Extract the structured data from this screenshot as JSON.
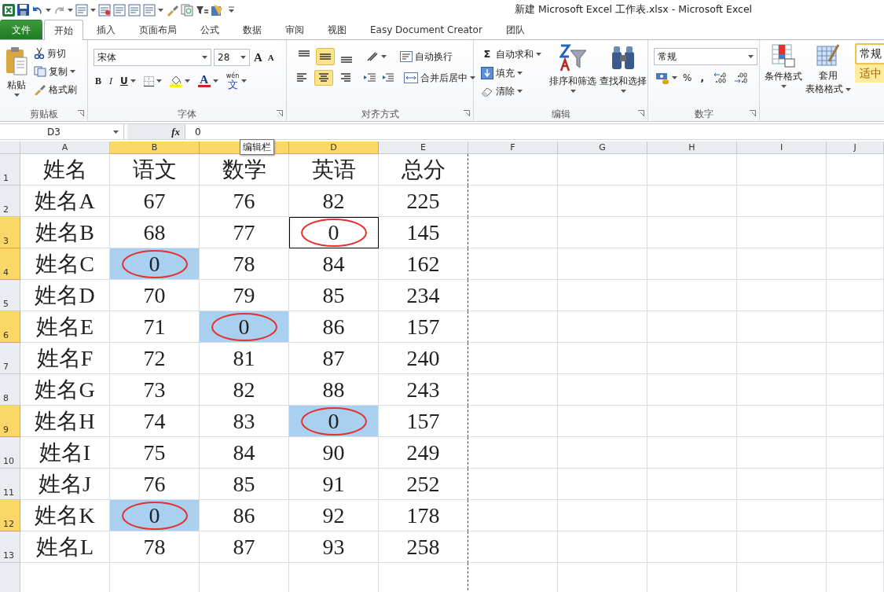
{
  "window": {
    "title": "新建 Microsoft Excel 工作表.xlsx  -  Microsoft Excel"
  },
  "tabs": [
    {
      "label": "文件",
      "kind": "file",
      "selected": false
    },
    {
      "label": "开始",
      "kind": "tab",
      "selected": true
    },
    {
      "label": "插入",
      "kind": "tab",
      "selected": false
    },
    {
      "label": "页面布局",
      "kind": "tab",
      "selected": false
    },
    {
      "label": "公式",
      "kind": "tab",
      "selected": false
    },
    {
      "label": "数据",
      "kind": "tab",
      "selected": false
    },
    {
      "label": "审阅",
      "kind": "tab",
      "selected": false
    },
    {
      "label": "视图",
      "kind": "tab",
      "selected": false
    },
    {
      "label": "Easy Document Creator",
      "kind": "tab",
      "selected": false
    },
    {
      "label": "团队",
      "kind": "tab",
      "selected": false
    }
  ],
  "ribbon": {
    "clipboard": {
      "title": "剪贴板",
      "paste": "粘贴",
      "cut": "剪切",
      "copy": "复制",
      "format_painter": "格式刷"
    },
    "font": {
      "title": "字体",
      "font_name": "宋体",
      "font_size": "28",
      "grow": "A",
      "shrink": "A",
      "bold": "B",
      "italic": "I",
      "underline": "U",
      "font_color": "A",
      "phonetic_top": "wén",
      "phonetic_main": "文"
    },
    "alignment": {
      "title": "对齐方式",
      "vertical": [
        {
          "selected": false
        },
        {
          "selected": true
        },
        {
          "selected": false
        }
      ],
      "horizontal": [
        {
          "selected": false
        },
        {
          "selected": true
        },
        {
          "selected": false
        }
      ],
      "wrap_text": "自动换行",
      "merge_center": "合并后居中"
    },
    "editing": {
      "title": "编辑",
      "autosum": "自动求和",
      "autosum_symbol": "Σ",
      "fill": "填充",
      "clear": "清除",
      "sort_filter": "排序和筛选",
      "find_select": "查找和选择"
    },
    "number": {
      "title": "数字",
      "format": "常规",
      "percent": "%",
      "comma": ","
    },
    "styles": {
      "conditional": "条件格式",
      "table_format_top": "套用",
      "table_format_bottom": "表格格式",
      "style_normal": "常规",
      "style_neutral": "适中"
    }
  },
  "formula_bar": {
    "name_box": "D3",
    "function_label": "fx",
    "formula": "0",
    "tooltip": "编辑栏"
  },
  "sheet": {
    "columns": [
      {
        "letter": "A",
        "selected": false
      },
      {
        "letter": "B",
        "selected": true
      },
      {
        "selected": true
      },
      {
        "letter": "D",
        "selected": true
      },
      {
        "letter": "E",
        "selected": false
      },
      {
        "letter": "F",
        "selected": false
      },
      {
        "letter": "G",
        "selected": false
      },
      {
        "letter": "H",
        "selected": false
      },
      {
        "letter": "I",
        "selected": false
      },
      {
        "letter": "J",
        "selected": false
      }
    ],
    "rows": [
      {
        "number": "1",
        "selected": false,
        "cells": [
          {
            "text": "姓名",
            "selected": false,
            "circled": false,
            "active": false
          },
          {
            "text": "语文",
            "selected": false,
            "circled": false,
            "active": false
          },
          {
            "text": "数学",
            "selected": false,
            "circled": false,
            "active": false
          },
          {
            "text": "英语",
            "selected": false,
            "circled": false,
            "active": false
          },
          {
            "text": "总分",
            "selected": false,
            "circled": false,
            "active": false
          }
        ]
      },
      {
        "number": "2",
        "selected": false,
        "cells": [
          {
            "text": "姓名A",
            "selected": false,
            "circled": false,
            "active": false
          },
          {
            "text": "67",
            "selected": false,
            "circled": false,
            "active": false
          },
          {
            "text": "76",
            "selected": false,
            "circled": false,
            "active": false
          },
          {
            "text": "82",
            "selected": false,
            "circled": false,
            "active": false
          },
          {
            "text": "225",
            "selected": false,
            "circled": false,
            "active": false
          }
        ]
      },
      {
        "number": "3",
        "selected": true,
        "cells": [
          {
            "text": "姓名B",
            "selected": false,
            "circled": false,
            "active": false
          },
          {
            "text": "68",
            "selected": false,
            "circled": false,
            "active": false
          },
          {
            "text": "77",
            "selected": false,
            "circled": false,
            "active": false
          },
          {
            "text": "0",
            "selected": false,
            "circled": true,
            "active": true
          },
          {
            "text": "145",
            "selected": false,
            "circled": false,
            "active": false
          }
        ]
      },
      {
        "number": "4",
        "selected": true,
        "cells": [
          {
            "text": "姓名C",
            "selected": false,
            "circled": false,
            "active": false
          },
          {
            "text": "0",
            "selected": true,
            "circled": true,
            "active": false
          },
          {
            "text": "78",
            "selected": false,
            "circled": false,
            "active": false
          },
          {
            "text": "84",
            "selected": false,
            "circled": false,
            "active": false
          },
          {
            "text": "162",
            "selected": false,
            "circled": false,
            "active": false
          }
        ]
      },
      {
        "number": "5",
        "selected": false,
        "cells": [
          {
            "text": "姓名D",
            "selected": false,
            "circled": false,
            "active": false
          },
          {
            "text": "70",
            "selected": false,
            "circled": false,
            "active": false
          },
          {
            "text": "79",
            "selected": false,
            "circled": false,
            "active": false
          },
          {
            "text": "85",
            "selected": false,
            "circled": false,
            "active": false
          },
          {
            "text": "234",
            "selected": false,
            "circled": false,
            "active": false
          }
        ]
      },
      {
        "number": "6",
        "selected": true,
        "cells": [
          {
            "text": "姓名E",
            "selected": false,
            "circled": false,
            "active": false
          },
          {
            "text": "71",
            "selected": false,
            "circled": false,
            "active": false
          },
          {
            "text": "0",
            "selected": true,
            "circled": true,
            "active": false
          },
          {
            "text": "86",
            "selected": false,
            "circled": false,
            "active": false
          },
          {
            "text": "157",
            "selected": false,
            "circled": false,
            "active": false
          }
        ]
      },
      {
        "number": "7",
        "selected": false,
        "cells": [
          {
            "text": "姓名F",
            "selected": false,
            "circled": false,
            "active": false
          },
          {
            "text": "72",
            "selected": false,
            "circled": false,
            "active": false
          },
          {
            "text": "81",
            "selected": false,
            "circled": false,
            "active": false
          },
          {
            "text": "87",
            "selected": false,
            "circled": false,
            "active": false
          },
          {
            "text": "240",
            "selected": false,
            "circled": false,
            "active": false
          }
        ]
      },
      {
        "number": "8",
        "selected": false,
        "cells": [
          {
            "text": "姓名G",
            "selected": false,
            "circled": false,
            "active": false
          },
          {
            "text": "73",
            "selected": false,
            "circled": false,
            "active": false
          },
          {
            "text": "82",
            "selected": false,
            "circled": false,
            "active": false
          },
          {
            "text": "88",
            "selected": false,
            "circled": false,
            "active": false
          },
          {
            "text": "243",
            "selected": false,
            "circled": false,
            "active": false
          }
        ]
      },
      {
        "number": "9",
        "selected": true,
        "cells": [
          {
            "text": "姓名H",
            "selected": false,
            "circled": false,
            "active": false
          },
          {
            "text": "74",
            "selected": false,
            "circled": false,
            "active": false
          },
          {
            "text": "83",
            "selected": false,
            "circled": false,
            "active": false
          },
          {
            "text": "0",
            "selected": true,
            "circled": true,
            "active": false
          },
          {
            "text": "157",
            "selected": false,
            "circled": false,
            "active": false
          }
        ]
      },
      {
        "number": "10",
        "selected": false,
        "cells": [
          {
            "text": "姓名I",
            "selected": false,
            "circled": false,
            "active": false
          },
          {
            "text": "75",
            "selected": false,
            "circled": false,
            "active": false
          },
          {
            "text": "84",
            "selected": false,
            "circled": false,
            "active": false
          },
          {
            "text": "90",
            "selected": false,
            "circled": false,
            "active": false
          },
          {
            "text": "249",
            "selected": false,
            "circled": false,
            "active": false
          }
        ]
      },
      {
        "number": "11",
        "selected": false,
        "cells": [
          {
            "text": "姓名J",
            "selected": false,
            "circled": false,
            "active": false
          },
          {
            "text": "76",
            "selected": false,
            "circled": false,
            "active": false
          },
          {
            "text": "85",
            "selected": false,
            "circled": false,
            "active": false
          },
          {
            "text": "91",
            "selected": false,
            "circled": false,
            "active": false
          },
          {
            "text": "252",
            "selected": false,
            "circled": false,
            "active": false
          }
        ]
      },
      {
        "number": "12",
        "selected": true,
        "cells": [
          {
            "text": "姓名K",
            "selected": false,
            "circled": false,
            "active": false
          },
          {
            "text": "0",
            "selected": true,
            "circled": true,
            "active": false
          },
          {
            "text": "86",
            "selected": false,
            "circled": false,
            "active": false
          },
          {
            "text": "92",
            "selected": false,
            "circled": false,
            "active": false
          },
          {
            "text": "178",
            "selected": false,
            "circled": false,
            "active": false
          }
        ]
      },
      {
        "number": "13",
        "selected": false,
        "cells": [
          {
            "text": "姓名L",
            "selected": false,
            "circled": false,
            "active": false
          },
          {
            "text": "78",
            "selected": false,
            "circled": false,
            "active": false
          },
          {
            "text": "87",
            "selected": false,
            "circled": false,
            "active": false
          },
          {
            "text": "93",
            "selected": false,
            "circled": false,
            "active": false
          },
          {
            "text": "258",
            "selected": false,
            "circled": false,
            "active": false
          }
        ]
      }
    ]
  }
}
